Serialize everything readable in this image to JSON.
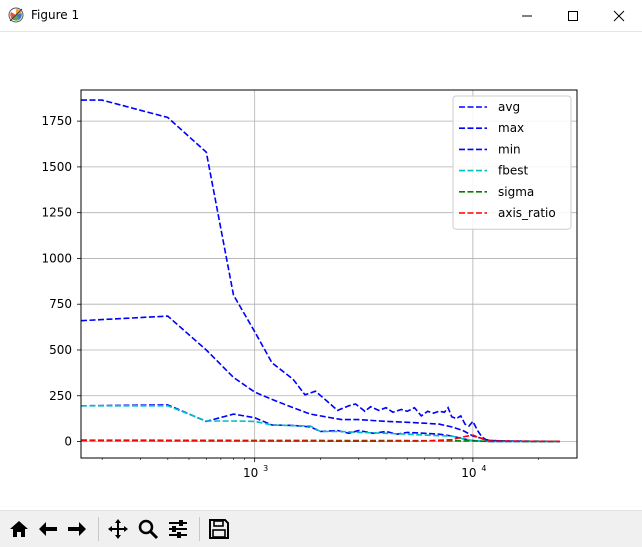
{
  "window": {
    "title": "Figure 1"
  },
  "toolbar": {
    "buttons": [
      "home-icon",
      "back-arrow-icon",
      "forward-arrow-icon",
      "pan-icon",
      "zoom-icon",
      "configure-subplots-icon",
      "save-icon"
    ]
  },
  "chart_data": {
    "type": "line",
    "xscale": "log",
    "xlim": [
      160,
      30000
    ],
    "ylim": [
      -90,
      1920
    ],
    "xticks": [
      {
        "value": 1000,
        "base": "10",
        "exp": "3"
      },
      {
        "value": 10000,
        "base": "10",
        "exp": "4"
      }
    ],
    "yticks": [
      {
        "value": 0,
        "label": "0"
      },
      {
        "value": 250,
        "label": "250"
      },
      {
        "value": 500,
        "label": "500"
      },
      {
        "value": 750,
        "label": "750"
      },
      {
        "value": 1000,
        "label": "1000"
      },
      {
        "value": 1250,
        "label": "1250"
      },
      {
        "value": 1500,
        "label": "1500"
      },
      {
        "value": 1750,
        "label": "1750"
      }
    ],
    "grid": true,
    "legend_position": "top-right",
    "series": [
      {
        "name": "avg",
        "color": "#0000ff",
        "style": "dashed",
        "x": [
          160,
          400,
          600,
          800,
          1000,
          1200,
          1500,
          1800,
          2500,
          3000,
          4000,
          5000,
          6000,
          7000,
          8000,
          9000,
          10000,
          12000,
          15000,
          20000,
          25000
        ],
        "y": [
          660,
          685,
          500,
          350,
          270,
          230,
          185,
          150,
          120,
          120,
          110,
          105,
          100,
          95,
          80,
          60,
          30,
          5,
          2,
          1,
          0
        ]
      },
      {
        "name": "max",
        "color": "#0000ff",
        "style": "dashed",
        "x": [
          160,
          200,
          400,
          600,
          800,
          1000,
          1200,
          1500,
          1700,
          1900,
          2100,
          2400,
          2700,
          2900,
          3200,
          3400,
          3700,
          4000,
          4300,
          4700,
          5000,
          5400,
          5800,
          6200,
          6600,
          7000,
          7400,
          7700,
          8000,
          8400,
          8800,
          9200,
          9600,
          10000,
          10500,
          11000,
          11500,
          12000,
          15000,
          20000,
          25000
        ],
        "y": [
          1865,
          1865,
          1770,
          1580,
          800,
          600,
          430,
          340,
          255,
          275,
          230,
          170,
          195,
          205,
          165,
          190,
          170,
          185,
          160,
          175,
          165,
          185,
          140,
          165,
          155,
          165,
          160,
          185,
          135,
          125,
          140,
          95,
          85,
          110,
          60,
          25,
          10,
          5,
          3,
          2,
          1
        ]
      },
      {
        "name": "min",
        "color": "#0000ff",
        "style": "dashed",
        "x": [
          160,
          400,
          600,
          800,
          1000,
          1200,
          1500,
          1800,
          2000,
          2400,
          2700,
          3000,
          3500,
          4000,
          4500,
          5000,
          6000,
          7000,
          8000,
          9000,
          10000,
          11000,
          12000,
          15000,
          20000,
          25000
        ],
        "y": [
          195,
          200,
          110,
          150,
          130,
          90,
          88,
          80,
          55,
          60,
          45,
          60,
          45,
          55,
          40,
          50,
          45,
          40,
          30,
          15,
          5,
          2,
          0,
          0,
          0,
          0
        ]
      },
      {
        "name": "fbest",
        "color": "#00bfbf",
        "style": "dashed",
        "x": [
          160,
          400,
          600,
          800,
          1000,
          1200,
          1500,
          1800,
          2000,
          2500,
          3000,
          4000,
          5000,
          6000,
          7000,
          8000,
          9000,
          10000,
          12000,
          15000,
          25000
        ],
        "y": [
          195,
          195,
          112,
          112,
          110,
          90,
          87,
          85,
          55,
          55,
          50,
          45,
          40,
          35,
          32,
          30,
          15,
          5,
          0,
          0,
          0
        ]
      },
      {
        "name": "sigma",
        "color": "#008000",
        "style": "dashed",
        "x": [
          160,
          1000,
          5000,
          8000,
          10000,
          12000,
          25000
        ],
        "y": [
          8,
          6,
          5,
          4,
          3,
          1,
          0
        ]
      },
      {
        "name": "axis_ratio",
        "color": "#ff0000",
        "style": "dashed",
        "x": [
          160,
          1000,
          3000,
          6000,
          8000,
          9000,
          10000,
          11000,
          12000,
          25000
        ],
        "y": [
          5,
          3,
          2,
          3,
          10,
          25,
          35,
          15,
          2,
          1
        ]
      }
    ]
  }
}
